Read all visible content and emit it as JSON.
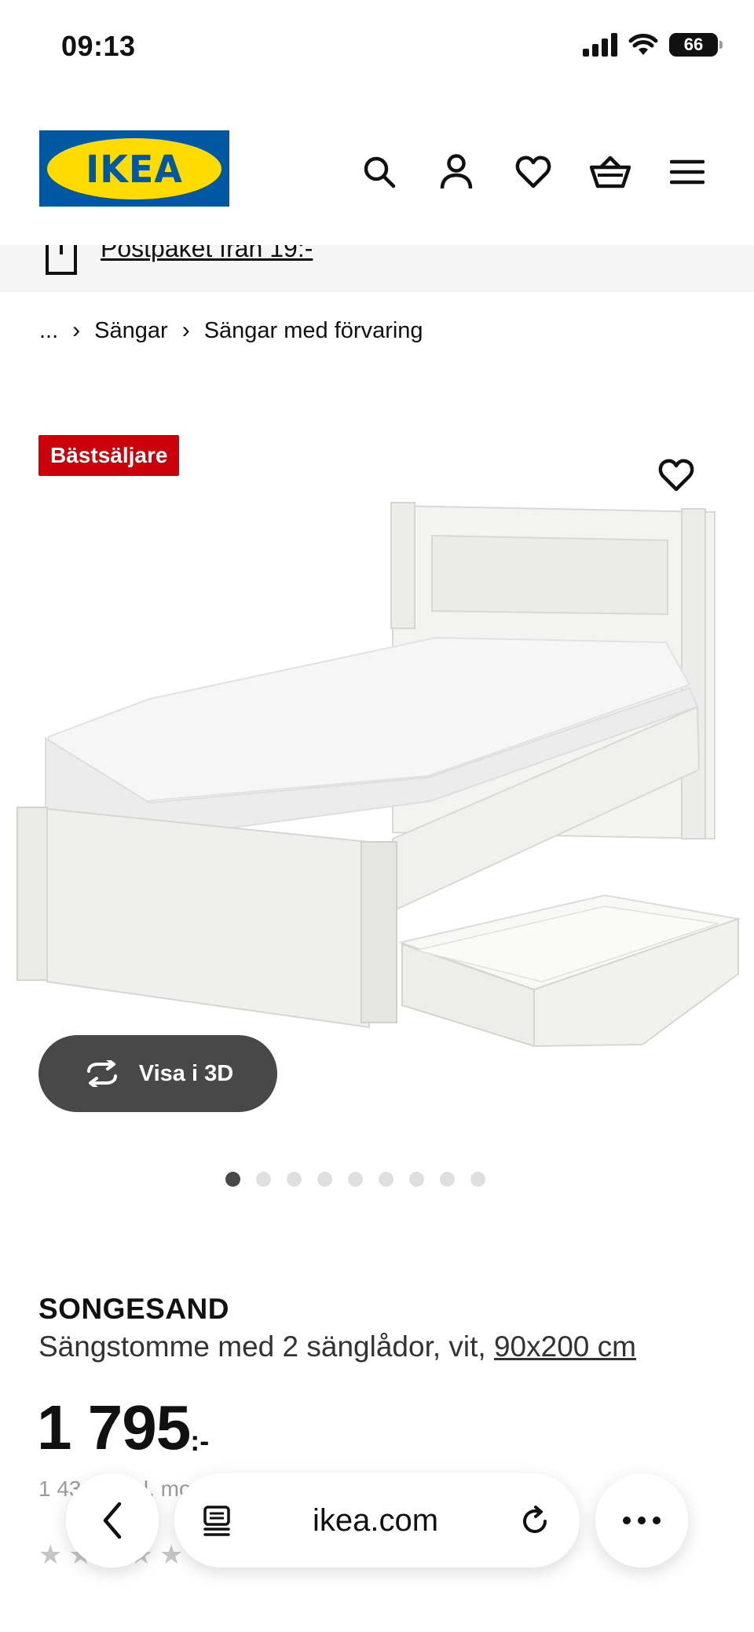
{
  "status_bar": {
    "time": "09:13",
    "battery": "66"
  },
  "header": {
    "logo_text": "IKEA",
    "icons": [
      "search-icon",
      "account-icon",
      "favourites-icon",
      "cart-icon",
      "menu-icon"
    ]
  },
  "delivery": {
    "text": "Postpaket från 19:-"
  },
  "breadcrumb": {
    "root": "...",
    "level1": "Sängar",
    "level2": "Sängar med förvaring",
    "separator": "›"
  },
  "gallery": {
    "badge": "Bästsäljare",
    "view3d_label": "Visa i 3D",
    "slide_count": 9,
    "active_slide": 1
  },
  "product": {
    "name": "SONGESAND",
    "description": "Sängstomme med 2 sänglådor, vit, ",
    "size": "90x200 cm",
    "price_integer": "1 795",
    "price_decimal": ":-",
    "price_sub": "1 43… exkl. moms",
    "rating_stars": "★★★★★"
  },
  "browser": {
    "url": "ikea.com"
  },
  "colors": {
    "brand_blue": "#0058a3",
    "brand_yellow": "#ffdb00",
    "badge_red": "#cc0008",
    "button_dark": "#484848"
  }
}
